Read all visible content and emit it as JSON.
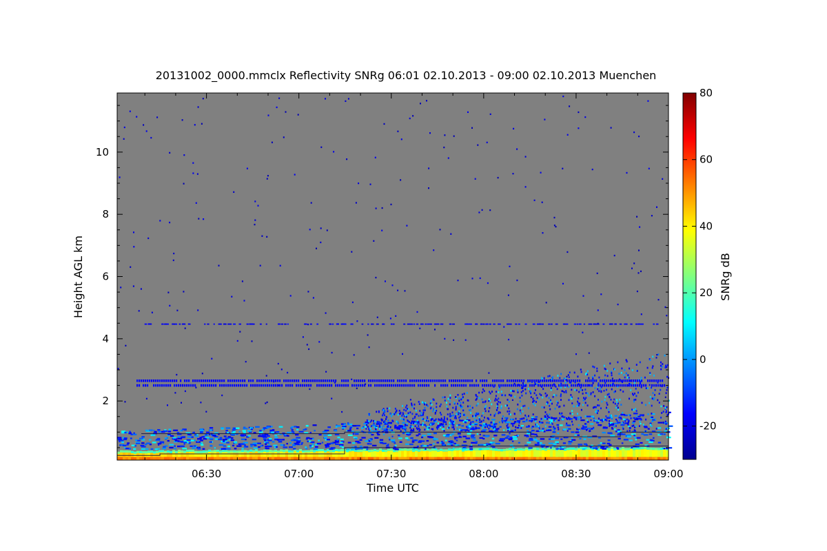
{
  "chart_data": {
    "type": "heatmap",
    "title": "20131002_0000.mmclx Reflectivity SNRg   06:01 02.10.2013 - 09:00 02.10.2013 Muenchen",
    "xlabel": "Time UTC",
    "ylabel": "Height AGL km",
    "colorbar_label": "SNRg dB",
    "x_range": [
      "06:01",
      "09:00"
    ],
    "y_range_km": [
      0.1,
      11.9
    ],
    "x_ticks": [
      "06:30",
      "07:00",
      "07:30",
      "08:00",
      "08:30",
      "09:00"
    ],
    "y_ticks": [
      2,
      4,
      6,
      8,
      10
    ],
    "colorbar_range_db": [
      -30,
      80
    ],
    "colorbar_ticks": [
      -20,
      0,
      20,
      40,
      60,
      80
    ],
    "background_color": "#808080",
    "colormap": [
      "#00008f",
      "#0000ff",
      "#0080ff",
      "#00ffff",
      "#80ff80",
      "#ffff00",
      "#ff8000",
      "#ff0000",
      "#800000"
    ],
    "features": [
      {
        "name": "surface layer",
        "height_km": [
          0.1,
          0.4
        ],
        "snr_db": 45
      },
      {
        "name": "boundary layer echoes",
        "height_km": [
          0.4,
          1.0
        ],
        "snr_db": 5
      },
      {
        "name": "horizontal band",
        "height_km": 2.65,
        "snr_db": -15
      },
      {
        "name": "horizontal band",
        "height_km": 2.5,
        "snr_db": -15
      },
      {
        "name": "scattered echoes",
        "height_km": 4.45,
        "snr_db": -15
      }
    ]
  }
}
